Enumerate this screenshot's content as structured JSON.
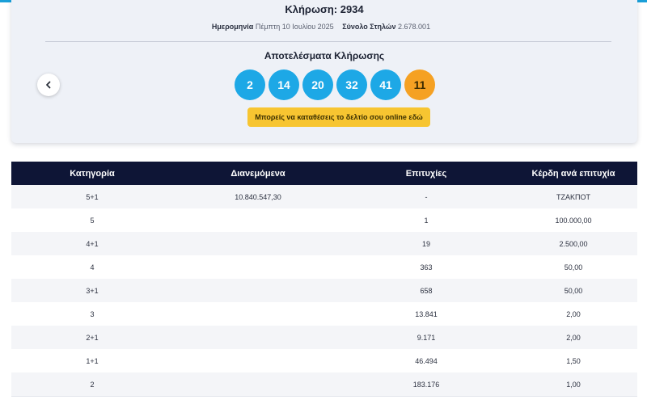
{
  "draw": {
    "title": "Κλήρωση: 2934",
    "date_label": "Ημερομηνία",
    "date_value": "Πέμπτη 10 Ιουλίου 2025",
    "columns_label": "Σύνολο Στηλών",
    "columns_value": "2.678.001",
    "results_title": "Αποτελέσματα Κλήρωσης",
    "numbers": [
      "2",
      "14",
      "20",
      "32",
      "41"
    ],
    "bonus": "11",
    "cta_label": "Μπορείς να καταθέσεις το δελτίο σου online εδώ"
  },
  "colors": {
    "ball": "#1da8e6",
    "bonus_ball": "#f5a123",
    "cta": "#f7c531",
    "table_header": "#0e1536"
  },
  "icons": {
    "prev": "chevron-left-icon"
  },
  "table": {
    "headers": [
      "Κατηγορία",
      "Διανεμόμενα",
      "Επιτυχίες",
      "Κέρδη ανά επιτυχία"
    ],
    "rows": [
      [
        "5+1",
        "10.840.547,30",
        "-",
        "ΤΖΑΚΠΟΤ"
      ],
      [
        "5",
        "",
        "1",
        "100.000,00"
      ],
      [
        "4+1",
        "",
        "19",
        "2.500,00"
      ],
      [
        "4",
        "",
        "363",
        "50,00"
      ],
      [
        "3+1",
        "",
        "658",
        "50,00"
      ],
      [
        "3",
        "",
        "13.841",
        "2,00"
      ],
      [
        "2+1",
        "",
        "9.171",
        "2,00"
      ],
      [
        "1+1",
        "",
        "46.494",
        "1,50"
      ],
      [
        "2",
        "",
        "183.176",
        "1,00"
      ]
    ]
  }
}
